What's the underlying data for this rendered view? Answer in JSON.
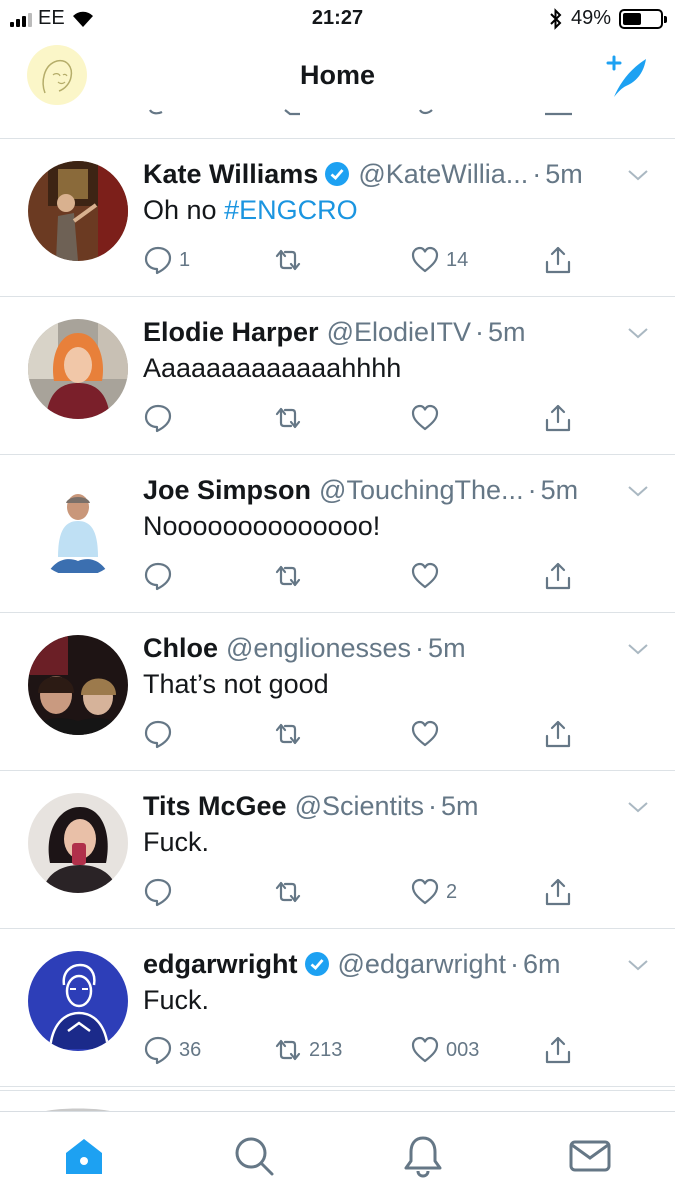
{
  "status_bar": {
    "carrier": "EE",
    "time": "21:27",
    "battery_percent": "49%",
    "battery_level": 0.49
  },
  "header": {
    "title": "Home"
  },
  "colors": {
    "accent": "#1da1f2",
    "hashtag": "#1b95e0",
    "secondary_text": "#657786",
    "divider": "#dde2e6"
  },
  "tweets": [
    {
      "name": "Kate Williams",
      "verified": true,
      "handle": "@KateWillia...",
      "time": "5m",
      "text": "Oh no ",
      "hashtag": "#ENGCRO",
      "reply_count": "1",
      "retweet_count": "",
      "like_count": "14"
    },
    {
      "name": "Elodie Harper",
      "verified": false,
      "handle": "@ElodieITV",
      "time": "5m",
      "text": "Aaaaaaaaaaaaahhhh",
      "hashtag": "",
      "reply_count": "",
      "retweet_count": "",
      "like_count": ""
    },
    {
      "name": "Joe Simpson",
      "verified": false,
      "handle": "@TouchingThe...",
      "time": "5m",
      "text": "Noooooooooooooo!",
      "hashtag": "",
      "reply_count": "",
      "retweet_count": "",
      "like_count": ""
    },
    {
      "name": "Chloe",
      "verified": false,
      "handle": "@englionesses",
      "time": "5m",
      "text": "That’s not good",
      "hashtag": "",
      "reply_count": "",
      "retweet_count": "",
      "like_count": ""
    },
    {
      "name": "Tits McGee",
      "verified": false,
      "handle": "@Scientits",
      "time": "5m",
      "text": "Fuck.",
      "hashtag": "",
      "reply_count": "",
      "retweet_count": "",
      "like_count": "2"
    },
    {
      "name": "edgarwright",
      "verified": true,
      "handle": "@edgarwright",
      "time": "6m",
      "text": "Fuck.",
      "hashtag": "",
      "reply_count": "36",
      "retweet_count": "213",
      "like_count": "003"
    }
  ],
  "tab_bar": {
    "items": [
      "home-icon",
      "search-icon",
      "notifications-icon",
      "messages-icon"
    ],
    "active": "home-icon"
  }
}
